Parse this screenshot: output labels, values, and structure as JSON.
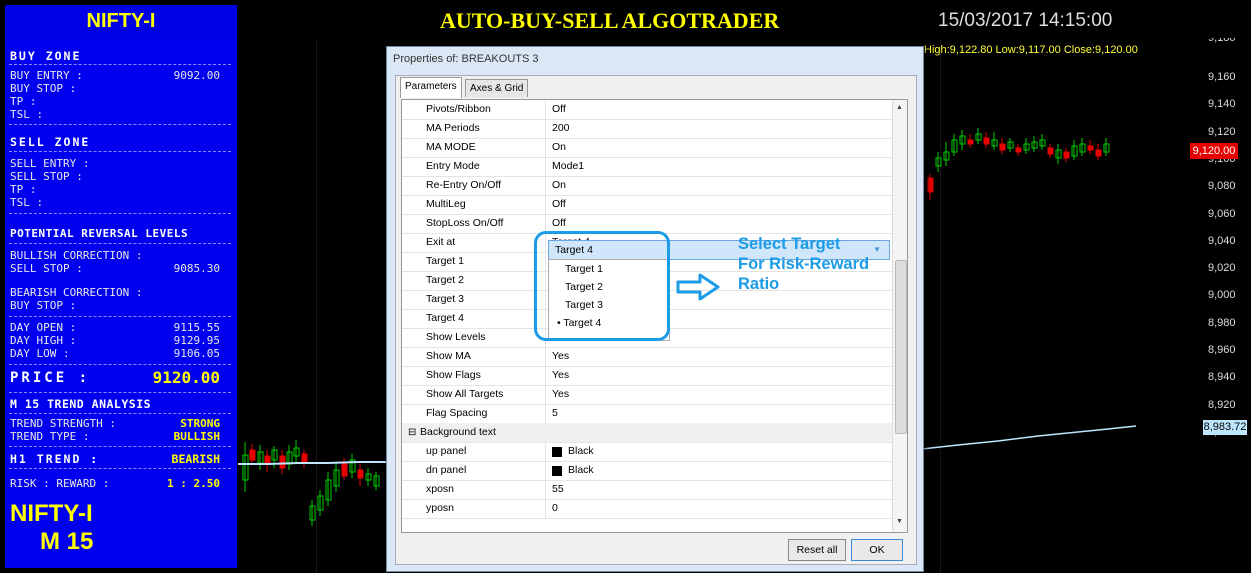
{
  "header": {
    "instrument": "NIFTY-I",
    "title": "AUTO-BUY-SELL ALGOTRADER",
    "datetime": "15/03/2017 14:15:00"
  },
  "left_panel": {
    "buy_zone": {
      "heading": "BUY ZONE",
      "entry_label": "BUY ENTRY :",
      "entry_value": "9092.00",
      "stop_label": "BUY STOP  :",
      "tp_label": "TP         :",
      "tsl_label": "TSL        :"
    },
    "sell_zone": {
      "heading": "SELL ZONE",
      "entry_label": "SELL ENTRY :",
      "stop_label": "SELL STOP  :",
      "tp_label": "TP         :",
      "tsl_label": "TSL        :"
    },
    "reversal": {
      "heading": "POTENTIAL REVERSAL LEVELS",
      "bullish_label": "BULLISH CORRECTION :",
      "sell_stop_label": "SELL STOP  :",
      "sell_stop_value": "9085.30",
      "bearish_label": "BEARISH CORRECTION :",
      "buy_stop_label": "BUY STOP   :"
    },
    "day": {
      "open_label": "DAY OPEN   :",
      "open_value": "9115.55",
      "high_label": "DAY HIGH   :",
      "high_value": "9129.95",
      "low_label": "DAY LOW    :",
      "low_value": "9106.05"
    },
    "price": {
      "label": "PRICE :",
      "value": "9120.00"
    },
    "trend": {
      "heading": "M 15 TREND ANALYSIS",
      "strength_label": "TREND STRENGTH :",
      "strength_value": "STRONG",
      "type_label": "TREND TYPE     :",
      "type_value": "BULLISH"
    },
    "h1": {
      "label": "H1 TREND :",
      "value": "BEARISH"
    },
    "risk": {
      "label": "RISK : REWARD  :",
      "value": "1 : 2.50"
    },
    "footer_symbol": "NIFTY-I",
    "footer_tf": "M 15"
  },
  "chart": {
    "ohlc_text": "High:9,122.80   Low:9,117.00   Close:9,120.00",
    "axis_labels": [
      "9,160",
      "9,140",
      "9,120",
      "9,100",
      "9,080",
      "9,060",
      "9,040",
      "9,020",
      "9,000",
      "8,980",
      "8,960",
      "8,940",
      "8,920",
      "8,900"
    ],
    "axis_top_partial": "9,180",
    "price_tag": "9,120.00",
    "ma_tag": "8,983.72",
    "colors": {
      "bull": "#00cc00",
      "bear": "#e60000",
      "ma": "#bde7ff",
      "panel": "#0000ee",
      "accent": "#ffff00"
    }
  },
  "dialog": {
    "title": "Properties of: BREAKOUTS 3",
    "tabs": [
      "Parameters",
      "Axes & Grid"
    ],
    "rows": [
      {
        "name": "Pivots/Ribbon",
        "value": "Off"
      },
      {
        "name": "MA Periods",
        "value": "200"
      },
      {
        "name": "MA MODE",
        "value": "On"
      },
      {
        "name": "Entry Mode",
        "value": "Mode1"
      },
      {
        "name": "Re-Entry On/Off",
        "value": "On"
      },
      {
        "name": "MultiLeg",
        "value": "Off"
      },
      {
        "name": "StopLoss On/Off",
        "value": "Off"
      },
      {
        "name": "Exit at",
        "value": "Target 4"
      },
      {
        "name": "Target 1",
        "value": ""
      },
      {
        "name": "Target 2",
        "value": ""
      },
      {
        "name": "Target 3",
        "value": ""
      },
      {
        "name": "Target 4",
        "value": ""
      },
      {
        "name": "Show Levels",
        "value": "No"
      },
      {
        "name": "Show MA",
        "value": "Yes"
      },
      {
        "name": "Show Flags",
        "value": "Yes"
      },
      {
        "name": "Show All Targets",
        "value": "Yes"
      },
      {
        "name": "Flag Spacing",
        "value": "5"
      },
      {
        "name": "Background text",
        "value": "",
        "category": true
      },
      {
        "name": "up panel",
        "value": "Black",
        "swatch": true
      },
      {
        "name": "dn panel",
        "value": "Black",
        "swatch": true
      },
      {
        "name": "xposn",
        "value": "55"
      },
      {
        "name": "yposn",
        "value": "0"
      }
    ],
    "dropdown": {
      "selected": "Target 4",
      "options": [
        "Target 1",
        "Target 2",
        "Target 3",
        "• Target 4"
      ]
    },
    "callout_text": "Select Target\nFor Risk-Reward\nRatio",
    "reset_label": "Reset all",
    "ok_label": "OK"
  }
}
